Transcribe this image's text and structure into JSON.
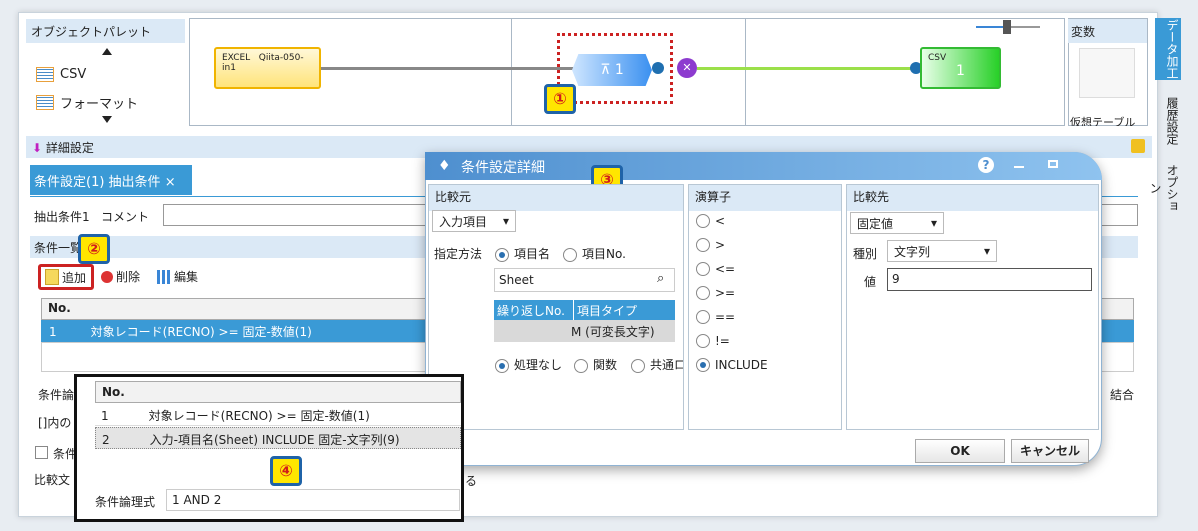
{
  "palette": {
    "title": "オブジェクトパレット",
    "items": [
      {
        "label": "CSV",
        "icon": "csv-file-icon"
      },
      {
        "label": "フォーマット",
        "icon": "format-icon"
      }
    ]
  },
  "canvas": {
    "nodes": {
      "excel_type": "EXCEL",
      "excel_name": "Qiita-050-in1",
      "filter_label": "1",
      "csv_type": "CSV",
      "csv_label": "1"
    }
  },
  "badges": {
    "b1": "①",
    "b2": "②",
    "b3": "③",
    "b4": "④"
  },
  "variables": {
    "title": "変数",
    "sub": "仮想テーブル"
  },
  "side_tabs": {
    "data": "データ加工",
    "history": "履歴設定",
    "option": "オプション"
  },
  "detail": {
    "title": "詳細設定",
    "tab": "条件設定(1) 抽出条件",
    "tab_close": "×",
    "cond_label": "抽出条件1",
    "comment_label": "コメント",
    "list_title": "条件一覧",
    "add": "追加",
    "delete": "削除",
    "edit": "編集",
    "table": {
      "col_no": "No.",
      "rows": [
        {
          "no": "1",
          "text": "対象レコード(RECNO)  >=  固定-数値(1)"
        }
      ]
    },
    "logic_label": "条件論",
    "bracket_label": "[]内の",
    "cond_check": "条件",
    "compare_label": "比較文",
    "right_join": "結合",
    "right_ru": "る"
  },
  "dialog": {
    "title": "条件設定詳細",
    "left": {
      "header": "比較元",
      "source_type": "入力項目",
      "method_label": "指定方法",
      "radio_name": "項目名",
      "radio_no": "項目No.",
      "search": "Sheet",
      "col1": "繰り返しNo.",
      "col2": "項目タイプ",
      "type_value": "M (可変長文字)",
      "proc_none": "処理なし",
      "proc_func": "関数",
      "proc_common": "共通ロ"
    },
    "ops": {
      "header": "演算子",
      "items": [
        "<",
        ">",
        "<=",
        ">=",
        "==",
        "!=",
        "INCLUDE"
      ],
      "selected": "INCLUDE"
    },
    "right": {
      "header": "比較先",
      "kind": "固定値",
      "type_label": "種別",
      "type_value": "文字列",
      "value_label": "値",
      "value": "9"
    },
    "ok": "OK",
    "cancel": "キャンセル"
  },
  "overlay": {
    "col_no": "No.",
    "rows": [
      {
        "no": "1",
        "text": "対象レコード(RECNO)  >=  固定-数値(1)"
      },
      {
        "no": "2",
        "text": "入力-項目名(Sheet)  INCLUDE  固定-文字列(9)"
      }
    ],
    "logic_label": "条件論理式",
    "logic_value": "1 AND 2"
  }
}
